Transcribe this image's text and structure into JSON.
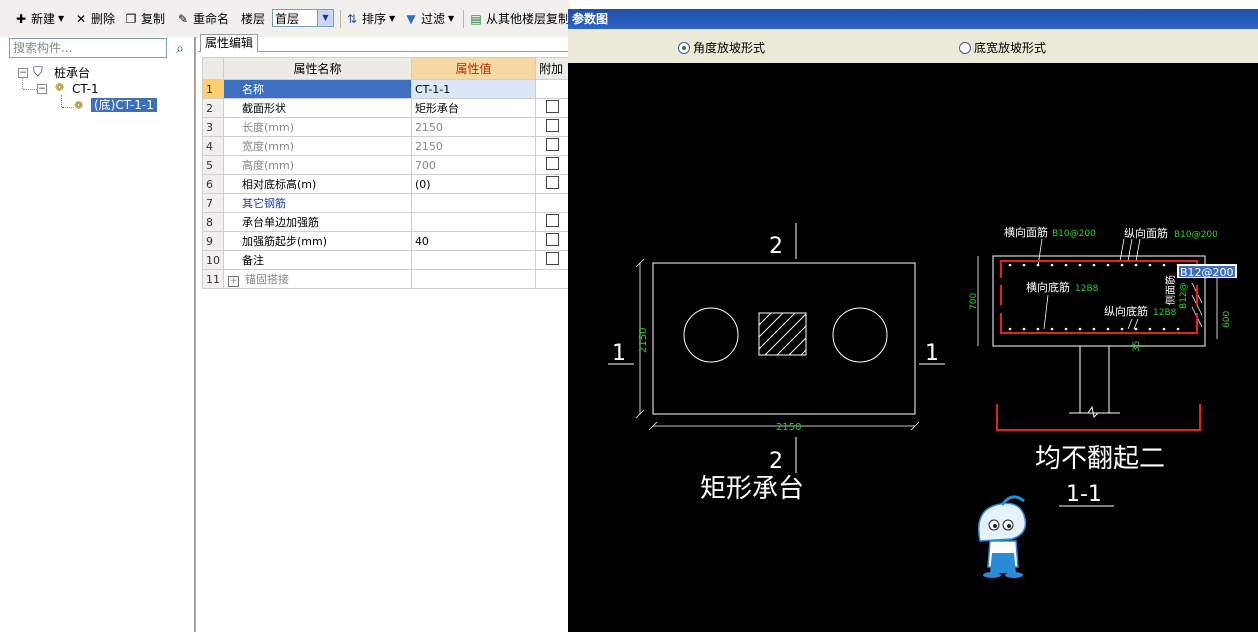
{
  "toolbar": {
    "new_label": "新建",
    "delete_label": "删除",
    "copy_label": "复制",
    "rename_label": "重命名",
    "floor_label": "楼层",
    "floor_value": "首层",
    "sort_label": "排序",
    "filter_label": "过滤",
    "copy_from_floor_label": "从其他楼层复制"
  },
  "search": {
    "placeholder": "搜索构件..."
  },
  "tree": {
    "root": "桩承台",
    "child": "CT-1",
    "leaf": "(底)CT-1-1"
  },
  "props": {
    "tab": "属性编辑",
    "headers": {
      "num": "",
      "name": "属性名称",
      "value": "属性值",
      "extra": "附加"
    },
    "rows": [
      {
        "n": "1",
        "name": "名称",
        "value": "CT-1-1"
      },
      {
        "n": "2",
        "name": "截面形状",
        "value": "矩形承台"
      },
      {
        "n": "3",
        "name": "长度(mm)",
        "value": "2150"
      },
      {
        "n": "4",
        "name": "宽度(mm)",
        "value": "2150"
      },
      {
        "n": "5",
        "name": "高度(mm)",
        "value": "700"
      },
      {
        "n": "6",
        "name": "相对底标高(m)",
        "value": "(0)"
      },
      {
        "n": "7",
        "name": "其它钢筋",
        "value": ""
      },
      {
        "n": "8",
        "name": "承台单边加强筋",
        "value": ""
      },
      {
        "n": "9",
        "name": "加强筋起步(mm)",
        "value": "40"
      },
      {
        "n": "10",
        "name": "备注",
        "value": ""
      },
      {
        "n": "11",
        "name": "锚固搭接",
        "value": ""
      }
    ]
  },
  "dialog": {
    "title": "参数图",
    "option_angle": "角度放坡形式",
    "option_width": "底宽放坡形式"
  },
  "drawing": {
    "section_2": "2",
    "section_1": "1",
    "dim_2150": "2150",
    "plan_title": "矩形承台",
    "top_bar_h": "横向面筋",
    "top_bar_h_val": "B10@200",
    "top_bar_v": "纵向面筋",
    "top_bar_v_val": "B10@200",
    "side_bar": "侧面筋",
    "side_bar_val": "B12@200",
    "side_bar_small": "B12@",
    "bottom_bar_h": "横向底筋",
    "bottom_bar_h_val": "12B8",
    "bottom_bar_v": "纵向底筋",
    "bottom_bar_v_val": "12B8",
    "dim_700": "700",
    "dim_600": "600",
    "dim_35": "35",
    "section_title": "均不翻起二",
    "section_label": "1-1"
  },
  "colors": {
    "accent_title": "#2c63c9",
    "drawing_bg": "#000000",
    "rebar_red": "#e8201c",
    "dim_green": "#22d422",
    "selected_row": "#3d6fbf"
  }
}
